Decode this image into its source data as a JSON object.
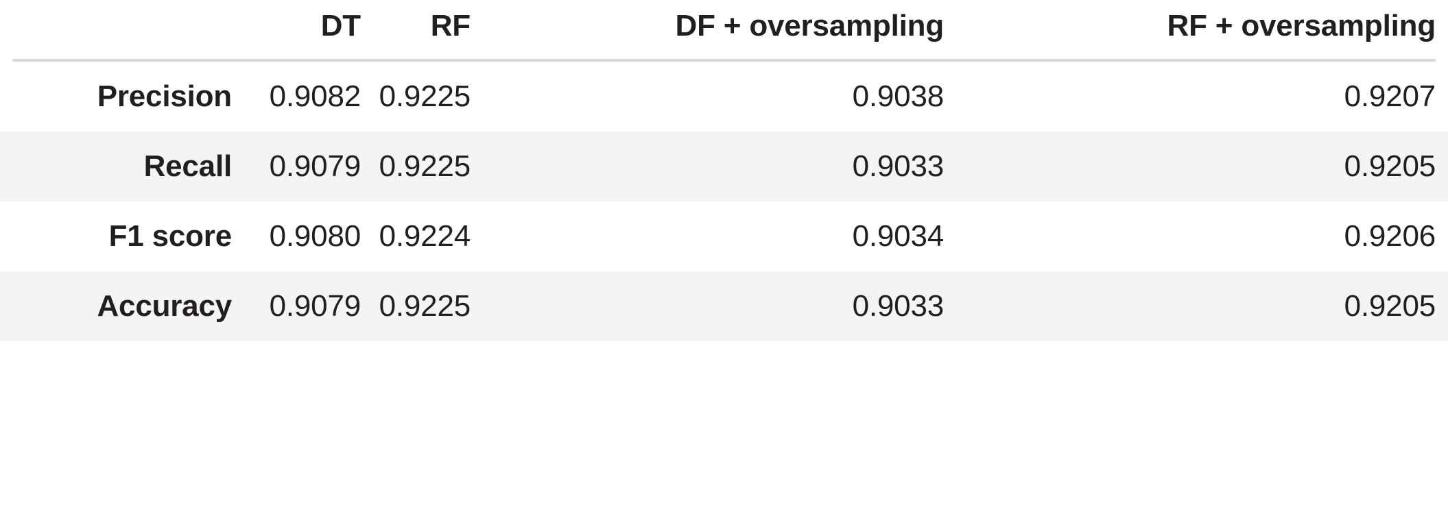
{
  "table": {
    "corner_label": "",
    "columns": [
      "DT",
      "RF",
      "DF + oversampling",
      "RF + oversampling"
    ],
    "row_header_label": "",
    "rows": [
      {
        "metric": "Precision",
        "values": [
          "0.9082",
          "0.9225",
          "0.9038",
          "0.9207"
        ]
      },
      {
        "metric": "Recall",
        "values": [
          "0.9079",
          "0.9225",
          "0.9033",
          "0.9205"
        ]
      },
      {
        "metric": "F1 score",
        "values": [
          "0.9080",
          "0.9224",
          "0.9034",
          "0.9206"
        ]
      },
      {
        "metric": "Accuracy",
        "values": [
          "0.9079",
          "0.9225",
          "0.9033",
          "0.9205"
        ]
      }
    ]
  },
  "chart_data": {
    "type": "table",
    "title": "",
    "categories": [
      "Precision",
      "Recall",
      "F1 score",
      "Accuracy"
    ],
    "series": [
      {
        "name": "DT",
        "values": [
          0.9082,
          0.9079,
          0.908,
          0.9079
        ]
      },
      {
        "name": "RF",
        "values": [
          0.9225,
          0.9225,
          0.9224,
          0.9225
        ]
      },
      {
        "name": "DF + oversampling",
        "values": [
          0.9038,
          0.9033,
          0.9034,
          0.9033
        ]
      },
      {
        "name": "RF + oversampling",
        "values": [
          0.9207,
          0.9205,
          0.9206,
          0.9205
        ]
      }
    ],
    "xlabel": "",
    "ylabel": "",
    "grid": false,
    "legend": "none"
  },
  "style": {
    "text_color": "#231f20",
    "header_rule_color": "#d9d9d9",
    "stripe_color": "#f4f4f4",
    "background": "#ffffff"
  }
}
